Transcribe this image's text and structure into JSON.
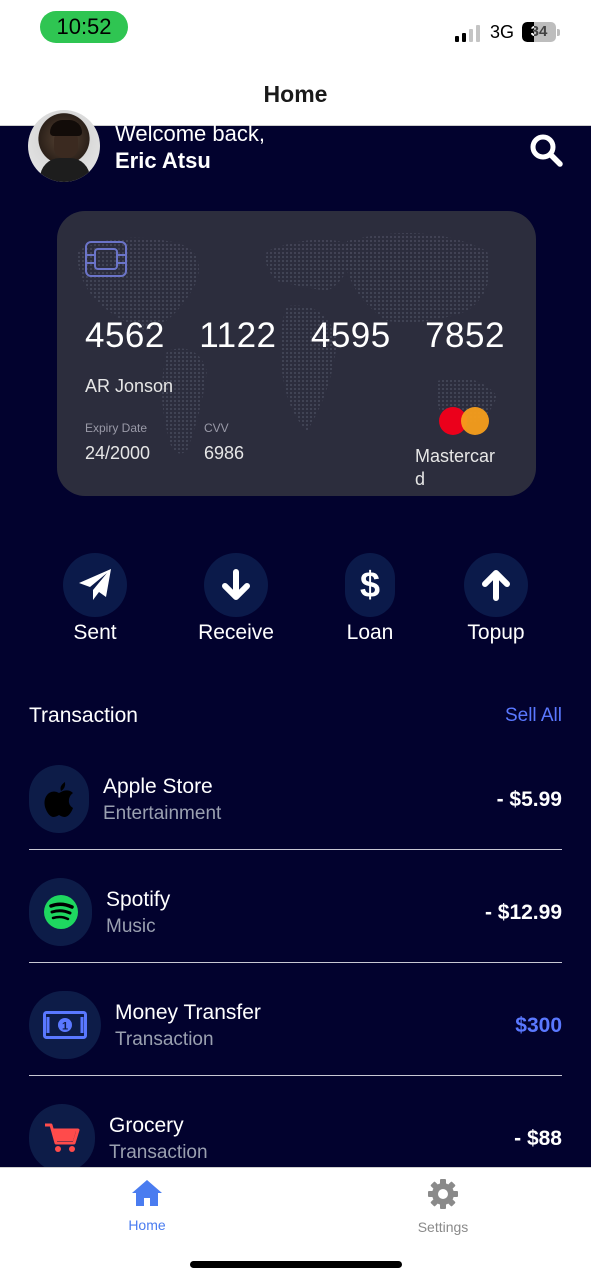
{
  "status_bar": {
    "time": "10:52",
    "network": "3G",
    "battery": "34",
    "battery_level": 0.34
  },
  "header": {
    "title": "Home"
  },
  "welcome": {
    "greeting": "Welcome back,",
    "name": "Eric Atsu"
  },
  "card": {
    "number_groups": [
      "4562",
      "1122",
      "4595",
      "7852"
    ],
    "holder": "AR Jonson",
    "expiry_label": "Expiry Date",
    "expiry_value": "24/2000",
    "cvv_label": "CVV",
    "cvv_value": "6986",
    "brand": "Mastercard",
    "colors": {
      "background": "#2c2d3d",
      "mc_red": "#eb001b",
      "mc_orange": "#f79e1b"
    }
  },
  "actions": [
    {
      "label": "Sent",
      "icon": "paper-plane-icon"
    },
    {
      "label": "Receive",
      "icon": "arrow-down-icon"
    },
    {
      "label": "Loan",
      "icon": "dollar-icon"
    },
    {
      "label": "Topup",
      "icon": "arrow-up-icon"
    }
  ],
  "transactions_section": {
    "title": "Transaction",
    "see_all": "Sell All"
  },
  "transactions": [
    {
      "name": "Apple Store",
      "category": "Entertainment",
      "amount": "- $5.99",
      "icon": "apple-icon"
    },
    {
      "name": "Spotify",
      "category": "Music",
      "amount": "- $12.99",
      "icon": "spotify-icon"
    },
    {
      "name": "Money Transfer",
      "category": "Transaction",
      "amount": "$300",
      "icon": "banknote-icon"
    },
    {
      "name": "Grocery",
      "category": "Transaction",
      "amount": "- $88",
      "icon": "cart-icon"
    }
  ],
  "tab_bar": {
    "items": [
      {
        "label": "Home",
        "icon": "home-icon",
        "active": true
      },
      {
        "label": "Settings",
        "icon": "gear-icon",
        "active": false
      }
    ]
  },
  "colors": {
    "background": "#02022e",
    "accent": "#5a78ff",
    "action_circle": "#0b1a4a",
    "time_pill": "#2fc552"
  }
}
